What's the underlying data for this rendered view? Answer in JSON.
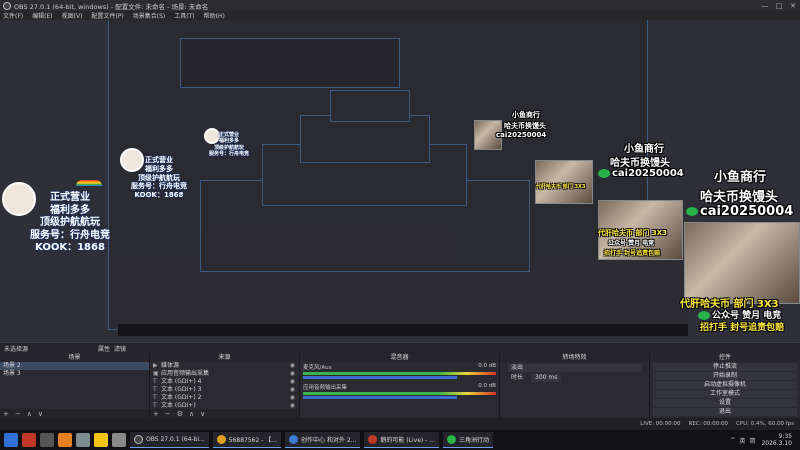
{
  "window": {
    "title": "OBS 27.0.1 (64-bit, windows) - 配置文件: 未命名 - 场景: 未命名",
    "controls": {
      "minimize": "—",
      "maximize": "□",
      "close": "✕"
    }
  },
  "menu": [
    "文件(F)",
    "编辑(E)",
    "视图(V)",
    "配置文件(P)",
    "场景集合(S)",
    "工具(T)",
    "帮助(H)"
  ],
  "overlay": {
    "card": [
      "正式营业",
      "福利多多",
      "顶级护航航玩",
      "服务号：行舟电竞",
      "KOOK：1868"
    ],
    "promo_top": "小鱼商行",
    "promo_mid": "哈夫币换馒头",
    "promo_id": "cai20250004",
    "promo_bottom": [
      "代肝哈夫币 部门 3X3",
      "公众号 赞月 电竞",
      "招打手 封号追责包赔"
    ]
  },
  "docks_header": {
    "label": "未选择源",
    "properties": "属性",
    "filters": "滤镜"
  },
  "scenes": {
    "title": "场景",
    "items": [
      "场景 2",
      "场景 3"
    ],
    "icons": [
      "+",
      "−",
      "∧",
      "∨"
    ]
  },
  "sources": {
    "title": "来源",
    "items": [
      {
        "icon": "▶",
        "label": "媒体源"
      },
      {
        "icon": "▣",
        "label": "应用音频输出采集"
      },
      {
        "icon": "T",
        "label": "文本 (GDI+) 4"
      },
      {
        "icon": "T",
        "label": "文本 (GDI+) 3"
      },
      {
        "icon": "T",
        "label": "文本 (GDI+) 2"
      },
      {
        "icon": "T",
        "label": "文本 (GDI+)"
      }
    ]
  },
  "mixer": {
    "title": "混音器",
    "tracks": [
      {
        "name": "麦克风/Aux",
        "db": "0.0 dB"
      },
      {
        "name": "应用音频输出采集",
        "db": "0.0 dB"
      }
    ]
  },
  "transitions": {
    "title": "转场特效",
    "type": "淡出",
    "duration_label": "时长",
    "duration": "300 ms"
  },
  "controls": {
    "title": "控件",
    "buttons": [
      "停止推流",
      "开始录制",
      "启动虚拟摄像机",
      "工作室模式",
      "设置",
      "退出"
    ]
  },
  "status": [
    "LIVE: 00:00:00",
    "REC: 00:00:00",
    "CPU: 0.4%, 60.00 fps"
  ],
  "taskbar": {
    "apps": [
      {
        "label": "OBS 27.0.1 (64-bi...",
        "color": "#444444"
      },
      {
        "label": "56887562 - 【...",
        "color": "#e0a020"
      },
      {
        "label": "创作中心 和对外 2...",
        "color": "#3a7bd5"
      },
      {
        "label": "鹅的可能 (Live) - ...",
        "color": "#c0392b"
      },
      {
        "label": "三角洲行动",
        "color": "#27b24a"
      }
    ],
    "tray": [
      "^",
      "英",
      "简"
    ],
    "time": "9:35",
    "date": "2026.3.10"
  }
}
